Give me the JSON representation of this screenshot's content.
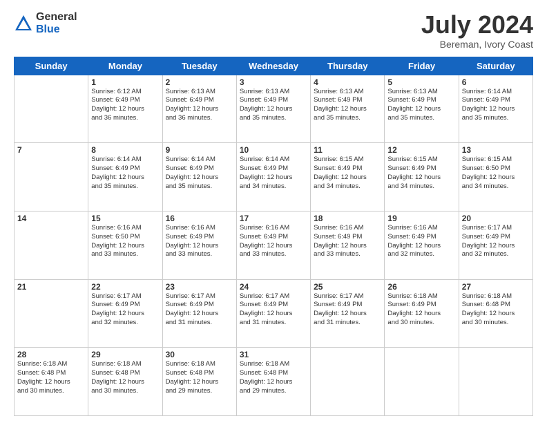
{
  "header": {
    "logo_general": "General",
    "logo_blue": "Blue",
    "month_title": "July 2024",
    "subtitle": "Bereman, Ivory Coast"
  },
  "days_of_week": [
    "Sunday",
    "Monday",
    "Tuesday",
    "Wednesday",
    "Thursday",
    "Friday",
    "Saturday"
  ],
  "weeks": [
    [
      {
        "day": "",
        "info": ""
      },
      {
        "day": "1",
        "info": "Sunrise: 6:12 AM\nSunset: 6:49 PM\nDaylight: 12 hours\nand 36 minutes."
      },
      {
        "day": "2",
        "info": "Sunrise: 6:13 AM\nSunset: 6:49 PM\nDaylight: 12 hours\nand 36 minutes."
      },
      {
        "day": "3",
        "info": "Sunrise: 6:13 AM\nSunset: 6:49 PM\nDaylight: 12 hours\nand 35 minutes."
      },
      {
        "day": "4",
        "info": "Sunrise: 6:13 AM\nSunset: 6:49 PM\nDaylight: 12 hours\nand 35 minutes."
      },
      {
        "day": "5",
        "info": "Sunrise: 6:13 AM\nSunset: 6:49 PM\nDaylight: 12 hours\nand 35 minutes."
      },
      {
        "day": "6",
        "info": "Sunrise: 6:14 AM\nSunset: 6:49 PM\nDaylight: 12 hours\nand 35 minutes."
      }
    ],
    [
      {
        "day": "7",
        "info": ""
      },
      {
        "day": "8",
        "info": "Sunrise: 6:14 AM\nSunset: 6:49 PM\nDaylight: 12 hours\nand 35 minutes."
      },
      {
        "day": "9",
        "info": "Sunrise: 6:14 AM\nSunset: 6:49 PM\nDaylight: 12 hours\nand 35 minutes."
      },
      {
        "day": "10",
        "info": "Sunrise: 6:14 AM\nSunset: 6:49 PM\nDaylight: 12 hours\nand 34 minutes."
      },
      {
        "day": "11",
        "info": "Sunrise: 6:15 AM\nSunset: 6:49 PM\nDaylight: 12 hours\nand 34 minutes."
      },
      {
        "day": "12",
        "info": "Sunrise: 6:15 AM\nSunset: 6:49 PM\nDaylight: 12 hours\nand 34 minutes."
      },
      {
        "day": "13",
        "info": "Sunrise: 6:15 AM\nSunset: 6:50 PM\nDaylight: 12 hours\nand 34 minutes."
      }
    ],
    [
      {
        "day": "14",
        "info": ""
      },
      {
        "day": "15",
        "info": "Sunrise: 6:16 AM\nSunset: 6:50 PM\nDaylight: 12 hours\nand 33 minutes."
      },
      {
        "day": "16",
        "info": "Sunrise: 6:16 AM\nSunset: 6:49 PM\nDaylight: 12 hours\nand 33 minutes."
      },
      {
        "day": "17",
        "info": "Sunrise: 6:16 AM\nSunset: 6:49 PM\nDaylight: 12 hours\nand 33 minutes."
      },
      {
        "day": "18",
        "info": "Sunrise: 6:16 AM\nSunset: 6:49 PM\nDaylight: 12 hours\nand 33 minutes."
      },
      {
        "day": "19",
        "info": "Sunrise: 6:16 AM\nSunset: 6:49 PM\nDaylight: 12 hours\nand 32 minutes."
      },
      {
        "day": "20",
        "info": "Sunrise: 6:17 AM\nSunset: 6:49 PM\nDaylight: 12 hours\nand 32 minutes."
      }
    ],
    [
      {
        "day": "21",
        "info": ""
      },
      {
        "day": "22",
        "info": "Sunrise: 6:17 AM\nSunset: 6:49 PM\nDaylight: 12 hours\nand 32 minutes."
      },
      {
        "day": "23",
        "info": "Sunrise: 6:17 AM\nSunset: 6:49 PM\nDaylight: 12 hours\nand 31 minutes."
      },
      {
        "day": "24",
        "info": "Sunrise: 6:17 AM\nSunset: 6:49 PM\nDaylight: 12 hours\nand 31 minutes."
      },
      {
        "day": "25",
        "info": "Sunrise: 6:17 AM\nSunset: 6:49 PM\nDaylight: 12 hours\nand 31 minutes."
      },
      {
        "day": "26",
        "info": "Sunrise: 6:18 AM\nSunset: 6:49 PM\nDaylight: 12 hours\nand 30 minutes."
      },
      {
        "day": "27",
        "info": "Sunrise: 6:18 AM\nSunset: 6:48 PM\nDaylight: 12 hours\nand 30 minutes."
      }
    ],
    [
      {
        "day": "28",
        "info": "Sunrise: 6:18 AM\nSunset: 6:48 PM\nDaylight: 12 hours\nand 30 minutes."
      },
      {
        "day": "29",
        "info": "Sunrise: 6:18 AM\nSunset: 6:48 PM\nDaylight: 12 hours\nand 30 minutes."
      },
      {
        "day": "30",
        "info": "Sunrise: 6:18 AM\nSunset: 6:48 PM\nDaylight: 12 hours\nand 29 minutes."
      },
      {
        "day": "31",
        "info": "Sunrise: 6:18 AM\nSunset: 6:48 PM\nDaylight: 12 hours\nand 29 minutes."
      },
      {
        "day": "",
        "info": ""
      },
      {
        "day": "",
        "info": ""
      },
      {
        "day": "",
        "info": ""
      }
    ]
  ]
}
